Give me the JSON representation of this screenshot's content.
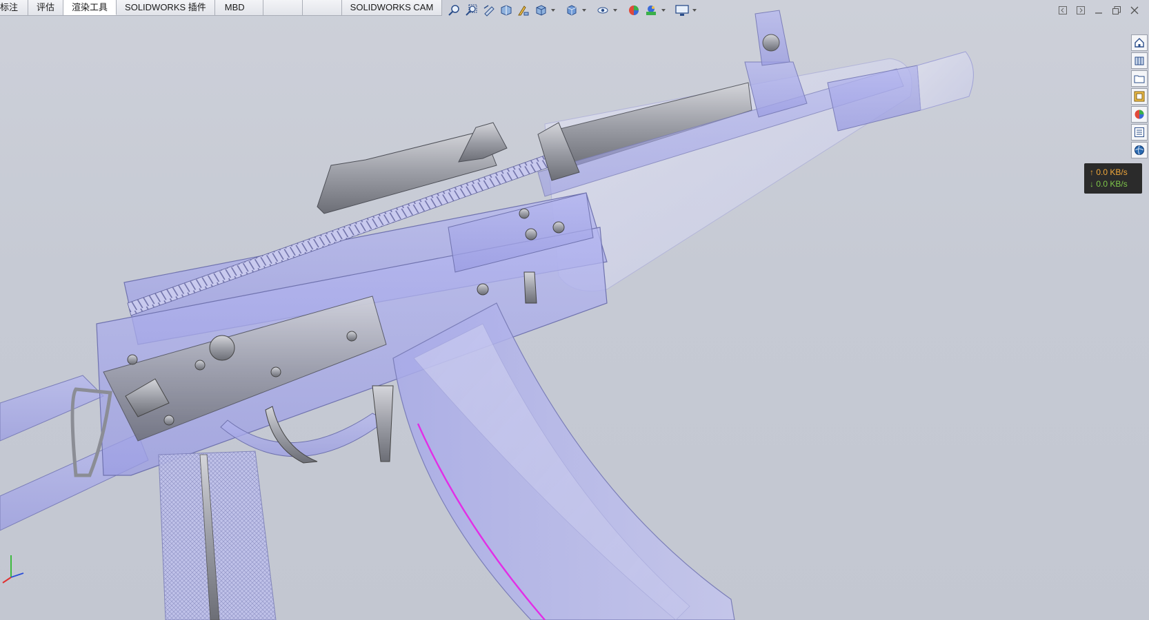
{
  "command_tabs": [
    {
      "label": "标注",
      "active": false
    },
    {
      "label": "评估",
      "active": false
    },
    {
      "label": "渲染工具",
      "active": true
    },
    {
      "label": "SOLIDWORKS 插件",
      "active": false
    },
    {
      "label": "MBD",
      "active": false
    },
    {
      "label": "",
      "active": false
    },
    {
      "label": "",
      "active": false
    },
    {
      "label": "SOLIDWORKS CAM",
      "active": false
    }
  ],
  "heads_up_toolbar": [
    "zoom-to-fit-icon",
    "zoom-to-area-icon",
    "previous-view-icon",
    "section-view-icon",
    "dynamic-annotation-icon",
    "view-orientation-icon",
    "display-style-icon",
    "hide-show-items-icon",
    "edit-appearance-icon",
    "apply-scene-icon",
    "view-settings-icon"
  ],
  "window_controls": [
    "tile-left-icon",
    "tile-right-icon",
    "minimize-icon",
    "restore-icon",
    "close-icon"
  ],
  "task_pane": [
    "solidworks-resources-icon",
    "design-library-icon",
    "file-explorer-icon",
    "view-palette-icon",
    "appearances-scenes-icon",
    "custom-properties-icon",
    "forum-icon"
  ],
  "network": {
    "upload": "↑ 0.0 KB/s",
    "download": "↓ 0.0 KB/s"
  },
  "colors": {
    "viewport_bg": "#c6cad4",
    "part_transparent": "#9c9ee6",
    "part_metal": "#8b8d95",
    "highlight_edge": "#e22ee6",
    "upload_text": "#f2a83a",
    "download_text": "#7fc84a"
  }
}
